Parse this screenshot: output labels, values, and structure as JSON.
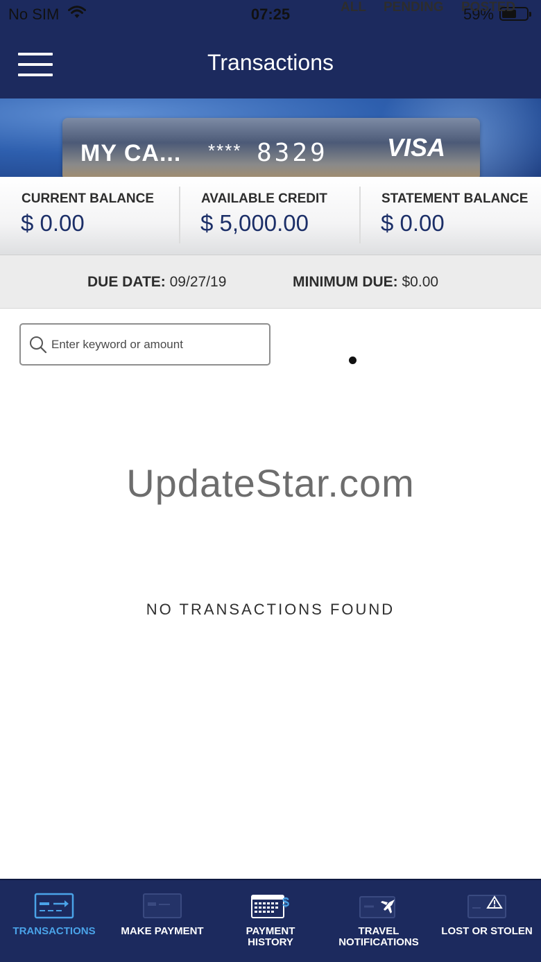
{
  "status_bar": {
    "carrier": "No SIM",
    "time": "07:25",
    "battery_percent": "59%",
    "battery_level": 0.59
  },
  "header": {
    "title": "Transactions",
    "menu_icon": "hamburger-menu-icon"
  },
  "card": {
    "name": "MY CA...",
    "masked": "****",
    "last_digits": "8329",
    "brand": "VISA"
  },
  "balances": [
    {
      "label": "CURRENT BALANCE",
      "value": "$ 0.00"
    },
    {
      "label": "AVAILABLE CREDIT",
      "value": "$ 5,000.00"
    },
    {
      "label": "STATEMENT BALANCE",
      "value": "$ 0.00"
    }
  ],
  "due": {
    "due_label": "DUE DATE:",
    "due_value": "09/27/19",
    "min_label": "MINIMUM DUE:",
    "min_value": "$0.00"
  },
  "search": {
    "placeholder": "Enter keyword or amount",
    "value": ""
  },
  "filters": {
    "all": "ALL",
    "pending": "PENDING",
    "posted": "POSTED",
    "selected": "ALL"
  },
  "watermark": "UpdateStar.com",
  "empty_message": "NO TRANSACTIONS FOUND",
  "tabs": [
    {
      "label": "TRANSACTIONS",
      "icon": "transactions-card-icon",
      "active": true
    },
    {
      "label": "MAKE PAYMENT",
      "icon": "payment-card-icon",
      "active": false
    },
    {
      "label": "PAYMENT HISTORY",
      "icon": "calendar-dollar-icon",
      "active": false
    },
    {
      "label": "TRAVEL NOTIFICATIONS",
      "icon": "airplane-card-icon",
      "active": false
    },
    {
      "label": "LOST OR STOLEN",
      "icon": "warning-card-icon",
      "active": false
    }
  ],
  "colors": {
    "navy": "#1c2a5e",
    "value_blue": "#1c2f68",
    "active_tab": "#4aa3e8"
  }
}
